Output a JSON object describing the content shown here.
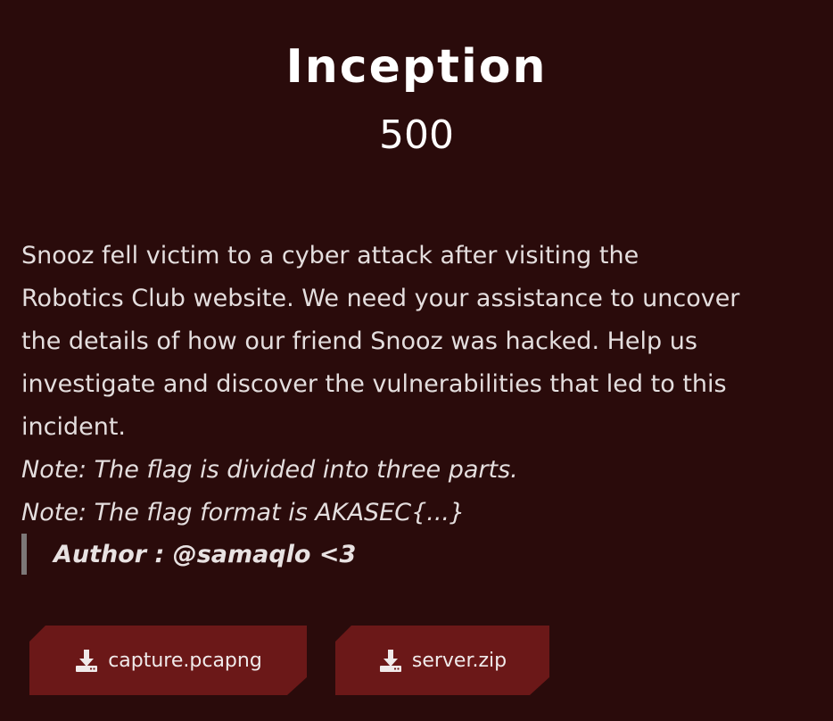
{
  "challenge": {
    "title": "Inception",
    "points": "500"
  },
  "description": {
    "lines": [
      "Snooz fell victim to a cyber attack after visiting the",
      "Robotics Club website. We need your assistance to uncover",
      "the details of how our friend Snooz was hacked. Help us",
      "investigate and discover the vulnerabilities that led to this",
      "incident."
    ],
    "notes": [
      "Note: The flag is divided into three parts.",
      "Note: The flag format is AKASEC{...}"
    ],
    "author": "Author : @samaqlo <3"
  },
  "files": [
    {
      "name": "capture.pcapng",
      "icon": "download-icon"
    },
    {
      "name": "server.zip",
      "icon": "download-icon"
    }
  ],
  "colors": {
    "background": "#2a0b0b",
    "button": "#6b1818",
    "quote_border": "#7d7878"
  }
}
